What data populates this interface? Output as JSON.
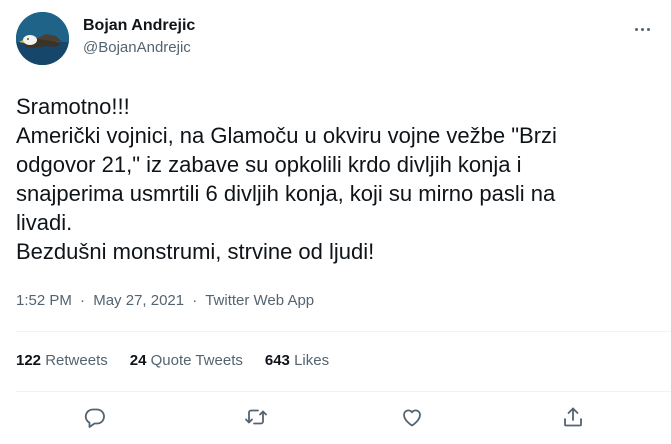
{
  "user": {
    "display_name": "Bojan Andrejic",
    "handle": "@BojanAndrejic",
    "avatar_icon": "eagle-avatar"
  },
  "tweet": {
    "lines": [
      "Sramotno!!!",
      "Američki vojnici, na Glamoču u okviru vojne vežbe \"Brzi",
      "odgovor 21,\" iz zabave su opkolili krdo divljih konja i",
      "snajperima usmrtili 6 divljih konja, koji su mirno pasli na",
      "livadi.",
      "Bezdušni monstrumi, strvine od ljudi!"
    ]
  },
  "meta": {
    "time": "1:52 PM",
    "separator": "·",
    "date": "May 27, 2021",
    "source": "Twitter Web App"
  },
  "stats": {
    "retweets_count": "122",
    "retweets_label": "Retweets",
    "quotes_count": "24",
    "quotes_label": "Quote Tweets",
    "likes_count": "643",
    "likes_label": "Likes"
  },
  "actions": [
    "reply-icon",
    "retweet-icon",
    "like-icon",
    "share-icon"
  ],
  "colors": {
    "text": "#0f1419",
    "secondary": "#536471",
    "divider": "#eff3f4"
  }
}
